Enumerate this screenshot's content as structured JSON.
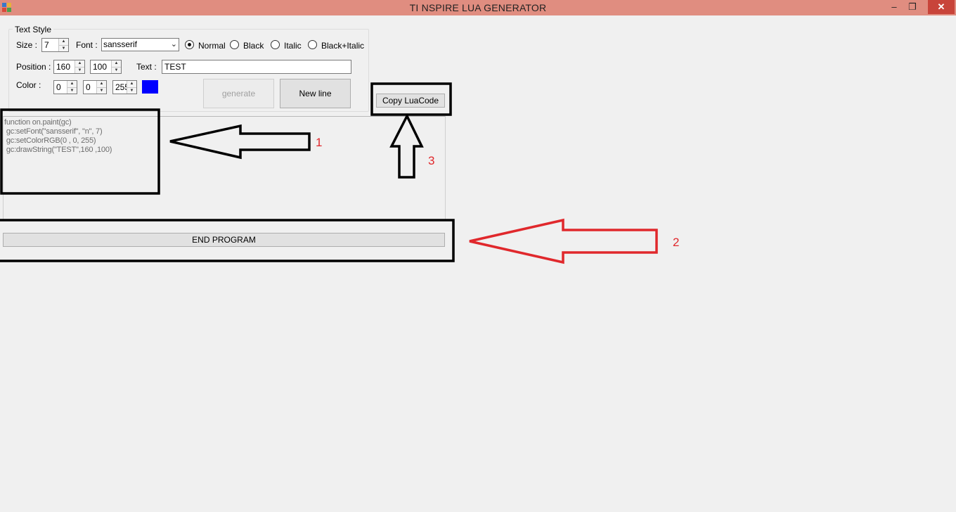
{
  "window": {
    "title": "TI NSPIRE LUA GENERATOR",
    "minimize_glyph": "–",
    "maximize_glyph": "❐",
    "close_glyph": "✕"
  },
  "text_style": {
    "group_label": "Text Style",
    "size_label": "Size :",
    "size_value": "7",
    "font_label": "Font :",
    "font_value": "sansserif",
    "radios": [
      {
        "label": "Normal",
        "checked": true
      },
      {
        "label": "Black",
        "checked": false
      },
      {
        "label": "Italic",
        "checked": false
      },
      {
        "label": "Black+Italic",
        "checked": false
      }
    ],
    "position_label": "Position :",
    "position_x": "160",
    "position_y": "100",
    "text_label": "Text :",
    "text_value": "TEST",
    "color_label": "Color :",
    "color_r": "0",
    "color_g": "0",
    "color_b": "255",
    "swatch_color": "#0000ff"
  },
  "buttons": {
    "generate": "generate",
    "new_line": "New line",
    "copy": "Copy LuaCode",
    "end": "END PROGRAM"
  },
  "code": {
    "lines": [
      "function on.paint(gc)",
      " gc:setFont(\"sansserif\", \"n\", 7)",
      " gc:setColorRGB(0 , 0, 255)",
      " gc:drawString(\"TEST\",160 ,100)"
    ]
  },
  "annotations": {
    "label_1": "1",
    "label_2": "2",
    "label_3": "3",
    "black": "#000000",
    "red": "#e0282c"
  }
}
